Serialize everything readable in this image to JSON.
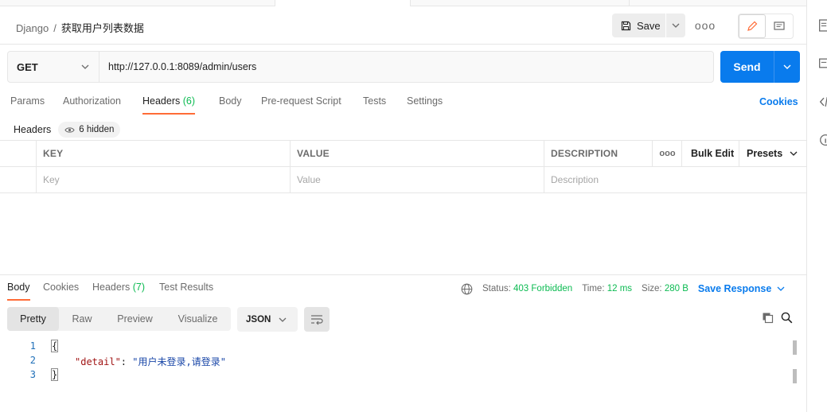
{
  "breadcrumb": {
    "parent": "Django",
    "separator": "/",
    "current": "获取用户列表数据"
  },
  "header": {
    "save_label": "Save",
    "more_label": "ooo"
  },
  "request": {
    "method": "GET",
    "url": "http://127.0.0.1:8089/admin/users",
    "send_label": "Send"
  },
  "request_tabs": [
    {
      "label": "Params"
    },
    {
      "label": "Authorization"
    },
    {
      "label": "Headers",
      "count": "(6)",
      "active": true
    },
    {
      "label": "Body"
    },
    {
      "label": "Pre-request Script"
    },
    {
      "label": "Tests"
    },
    {
      "label": "Settings"
    }
  ],
  "cookies_link": "Cookies",
  "headers_panel": {
    "title": "Headers",
    "hidden_label": "6 hidden",
    "columns": {
      "key": "KEY",
      "value": "VALUE",
      "description": "DESCRIPTION"
    },
    "more_label": "ooo",
    "bulk_edit": "Bulk Edit",
    "presets": "Presets",
    "placeholders": {
      "key": "Key",
      "value": "Value",
      "description": "Description"
    }
  },
  "response_tabs": [
    {
      "label": "Body",
      "active": true
    },
    {
      "label": "Cookies"
    },
    {
      "label": "Headers",
      "count": "(7)"
    },
    {
      "label": "Test Results"
    }
  ],
  "response_status": {
    "status_label": "Status:",
    "status_value": "403 Forbidden",
    "time_label": "Time:",
    "time_value": "12 ms",
    "size_label": "Size:",
    "size_value": "280 B",
    "save_response": "Save Response"
  },
  "response_formats": [
    "Pretty",
    "Raw",
    "Preview",
    "Visualize"
  ],
  "response_language": "JSON",
  "code": {
    "line_numbers": [
      "1",
      "2",
      "3"
    ],
    "open_brace": "{",
    "close_brace": "}",
    "key": "\"detail\"",
    "colon": ": ",
    "value": "\"用户未登录,请登录\""
  },
  "colors": {
    "primary": "#097bed",
    "accent": "#ff6c37",
    "success": "#0cbb52"
  },
  "icons": [
    "save-icon",
    "chevron-down-icon",
    "pencil-icon",
    "comment-icon",
    "eye-icon",
    "globe-icon",
    "wrap-icon",
    "copy-icon",
    "search-icon"
  ]
}
